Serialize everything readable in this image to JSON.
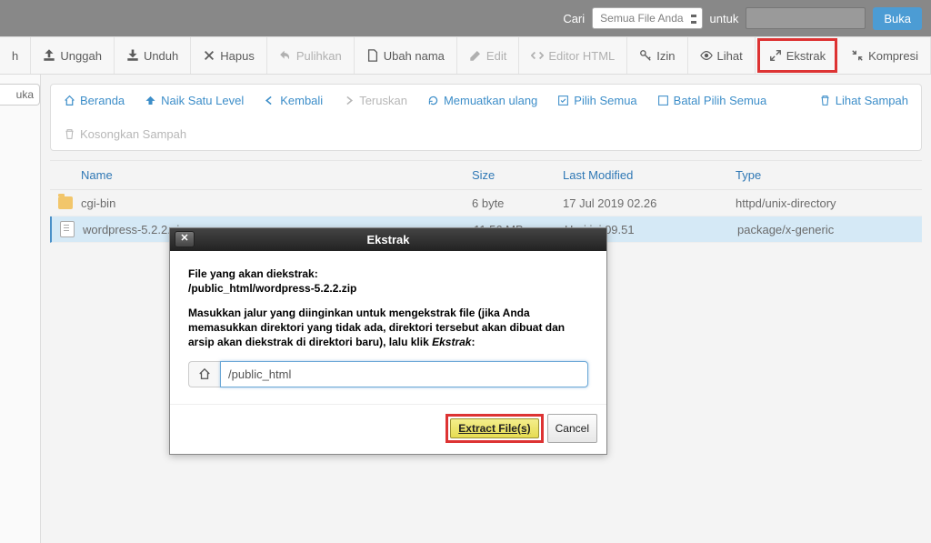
{
  "search": {
    "label": "Cari",
    "dropdown": "Semua File Anda",
    "for": "untuk",
    "go": "Buka"
  },
  "toolbar": {
    "partial_first": "h",
    "unggah": "Unggah",
    "unduh": "Unduh",
    "hapus": "Hapus",
    "pulihkan": "Pulihkan",
    "ubah": "Ubah nama",
    "edit": "Edit",
    "editor_html": "Editor HTML",
    "izin": "Izin",
    "lihat": "Lihat",
    "ekstrak": "Ekstrak",
    "kompresi": "Kompresi"
  },
  "side": {
    "tab": "uka"
  },
  "nav": {
    "beranda": "Beranda",
    "naik": "Naik Satu Level",
    "kembali": "Kembali",
    "teruskan": "Teruskan",
    "muat": "Memuatkan ulang",
    "pilih_semua": "Pilih Semua",
    "batal": "Batal Pilih Semua",
    "sampah": "Lihat Sampah",
    "kosong": "Kosongkan Sampah"
  },
  "table": {
    "headers": {
      "name": "Name",
      "size": "Size",
      "modified": "Last Modified",
      "type": "Type"
    },
    "rows": [
      {
        "name": "cgi-bin",
        "size": "6 byte",
        "modified": "17 Jul 2019 02.26",
        "type": "httpd/unix-directory",
        "kind": "folder"
      },
      {
        "name": "wordpress-5.2.2.zip",
        "size": "11,56 MB",
        "modified": "Hari ini 09.51",
        "type": "package/x-generic",
        "kind": "file"
      }
    ]
  },
  "dialog": {
    "title": "Ekstrak",
    "line1": "File yang akan diekstrak:",
    "line2": "/public_html/wordpress-5.2.2.zip",
    "desc_a": "Masukkan jalur yang diinginkan untuk mengekstrak file (jika Anda memasukkan direktori yang tidak ada, direktori tersebut akan dibuat dan arsip akan diekstrak di direktori baru), lalu klik ",
    "desc_b": "Ekstrak",
    "path": "/public_html",
    "extract": "Extract File(s)",
    "cancel": "Cancel"
  }
}
